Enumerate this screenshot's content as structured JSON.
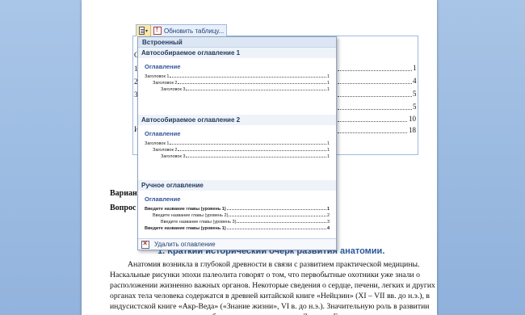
{
  "control_tab": {
    "refresh_label": "Обновить таблицу..."
  },
  "toc_behind": {
    "left_glyphs": [
      "С",
      "1",
      "2",
      "3",
      "И"
    ],
    "page_numbers": [
      "1",
      "4",
      "5",
      "5",
      "10",
      "18"
    ]
  },
  "gallery": {
    "header": "Встроенный",
    "sections": [
      {
        "title": "Автособираемое оглавление 1",
        "toc_heading": "Оглавление",
        "lines": [
          {
            "text": "Заголовок 1",
            "page": "1",
            "indent": 0
          },
          {
            "text": "Заголовок 2",
            "page": "1",
            "indent": 1
          },
          {
            "text": "Заголовок 3",
            "page": "1",
            "indent": 2
          }
        ]
      },
      {
        "title": "Автособираемое оглавление 2",
        "toc_heading": "Оглавление",
        "lines": [
          {
            "text": "Заголовок 1",
            "page": "1",
            "indent": 0
          },
          {
            "text": "Заголовок 2",
            "page": "1",
            "indent": 1
          },
          {
            "text": "Заголовок 3",
            "page": "1",
            "indent": 2
          }
        ]
      },
      {
        "title": "Ручное оглавление",
        "toc_heading": "Оглавление",
        "lines": [
          {
            "text": "Введите название главы (уровень 1)",
            "page": "1",
            "indent": 0,
            "bold": true
          },
          {
            "text": "Введите название главы (уровень 2)",
            "page": "2",
            "indent": 1
          },
          {
            "text": "Введите название главы (уровень 3)",
            "page": "3",
            "indent": 2
          },
          {
            "text": "Введите название главы (уровень 1)",
            "page": "4",
            "indent": 0,
            "bold": true
          }
        ]
      }
    ],
    "footer_label": "Удалить оглавление"
  },
  "document": {
    "variant_label": "Варианг",
    "question_label": "Вопрос",
    "heading": "1. Краткий исторический очерк развития анатомии.",
    "paragraph_lines": [
      "Анатомия возникла в глубокой древности в связи с развитием практической медицины.",
      "Наскальные рисунки эпохи палеолита говорят о том, что первобытные охотники уже знали о",
      "расположении жизненно важных органов. Некоторые сведения о сердце, печени, легких и других",
      "органах тела человека содержатся в древней китайской книге «Нейцзин» (XI – VII вв. до н.э.), в",
      "индусистской книге «Акр-Веда» («Знание жизни», VI в. до н.э.). Значительную роль в развитии",
      "анатомии сыграло ритуальное бальзамирование трупов в Древнем Египте."
    ]
  }
}
